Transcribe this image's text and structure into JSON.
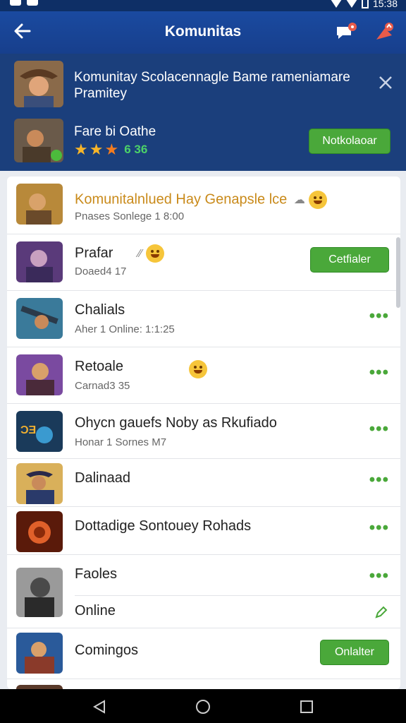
{
  "status": {
    "time": "15:38"
  },
  "app_bar": {
    "title": "Komunitas"
  },
  "header": {
    "promo_text": "Komunitay Scolacennagle Bame rameniamare Pramitey",
    "game_name": "Fare bi Oathe",
    "rating": "6 36",
    "button_label": "Notkolaoar"
  },
  "list": {
    "items": [
      {
        "title": "Komunitalnlued Hay Genapsle lce",
        "subtitle": "Pnases Sonlege 1 8:00"
      },
      {
        "title": "Prafar",
        "subtitle": "Doaed4 17",
        "button_label": "Cetfialer"
      },
      {
        "title": "Chalials",
        "subtitle": "Aher 1 Online: 1:1:25"
      },
      {
        "title": "Retoale",
        "subtitle": "Carnad3 35"
      },
      {
        "title": "Ohycn gauefs Noby as Rkufiado",
        "subtitle": "Honar 1 Sornes M7"
      },
      {
        "title": "Dalinaad"
      },
      {
        "title": "Dottadige Sontouey Rohads"
      },
      {
        "title": "Faoles",
        "subtitle": "Online"
      },
      {
        "title": "Comingos",
        "button_label": "Onlalter"
      }
    ]
  }
}
